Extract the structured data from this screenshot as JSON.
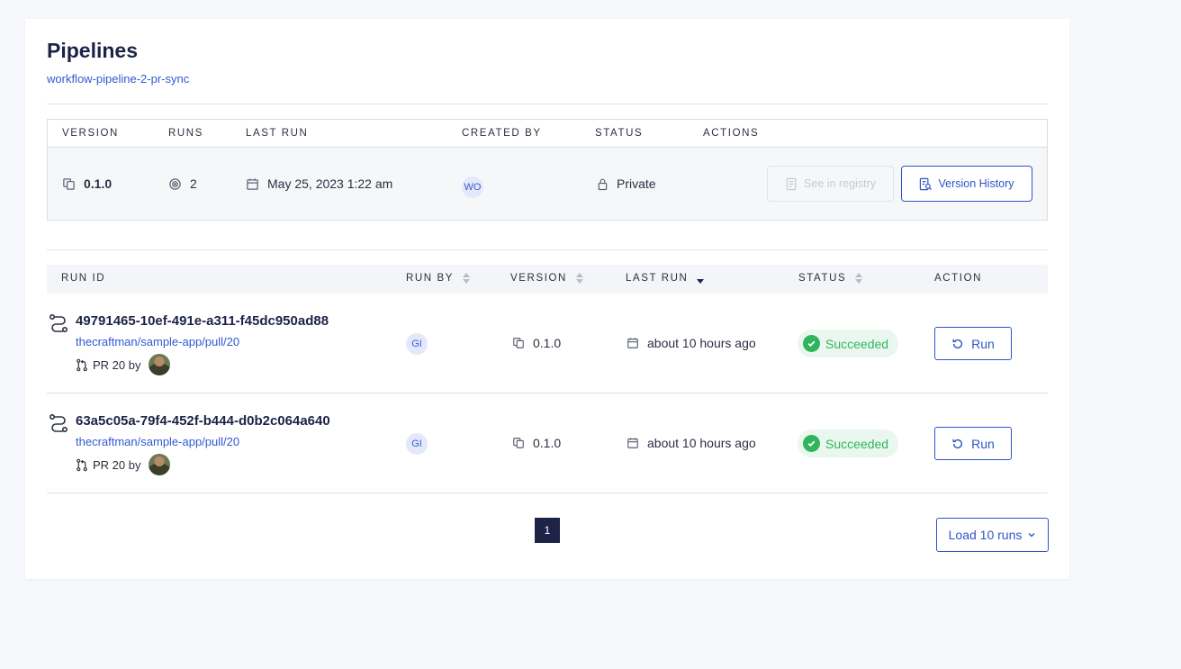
{
  "page": {
    "title": "Pipelines",
    "pipeline_name": "workflow-pipeline-2-pr-sync"
  },
  "version_table": {
    "headers": {
      "version": "VERSION",
      "runs": "RUNS",
      "last_run": "LAST RUN",
      "created_by": "CREATED BY",
      "status": "STATUS",
      "actions": "ACTIONS"
    },
    "row": {
      "version": "0.1.0",
      "runs": "2",
      "last_run": "May 25, 2023 1:22 am",
      "created_by": "WO",
      "status": "Private",
      "see_in_registry": "See in registry",
      "version_history": "Version History"
    }
  },
  "runs_table": {
    "headers": {
      "run_id": "RUN ID",
      "run_by": "RUN BY",
      "version": "VERSION",
      "last_run": "LAST RUN",
      "status": "STATUS",
      "action": "ACTION"
    },
    "rows": [
      {
        "run_id": "49791465-10ef-491e-a311-f45dc950ad88",
        "link": "thecraftman/sample-app/pull/20",
        "pr": "PR 20 by",
        "run_by": "GI",
        "version": "0.1.0",
        "last_run": "about 10 hours ago",
        "status": "Succeeded",
        "action": "Run"
      },
      {
        "run_id": "63a5c05a-79f4-452f-b444-d0b2c064a640",
        "link": "thecraftman/sample-app/pull/20",
        "pr": "PR 20 by",
        "run_by": "GI",
        "version": "0.1.0",
        "last_run": "about 10 hours ago",
        "status": "Succeeded",
        "action": "Run"
      }
    ]
  },
  "pagination": {
    "current_page": "1",
    "load_more": "Load 10 runs"
  },
  "colors": {
    "accent": "#2f55c8",
    "navy": "#1d2347",
    "success": "#2fb65c"
  }
}
